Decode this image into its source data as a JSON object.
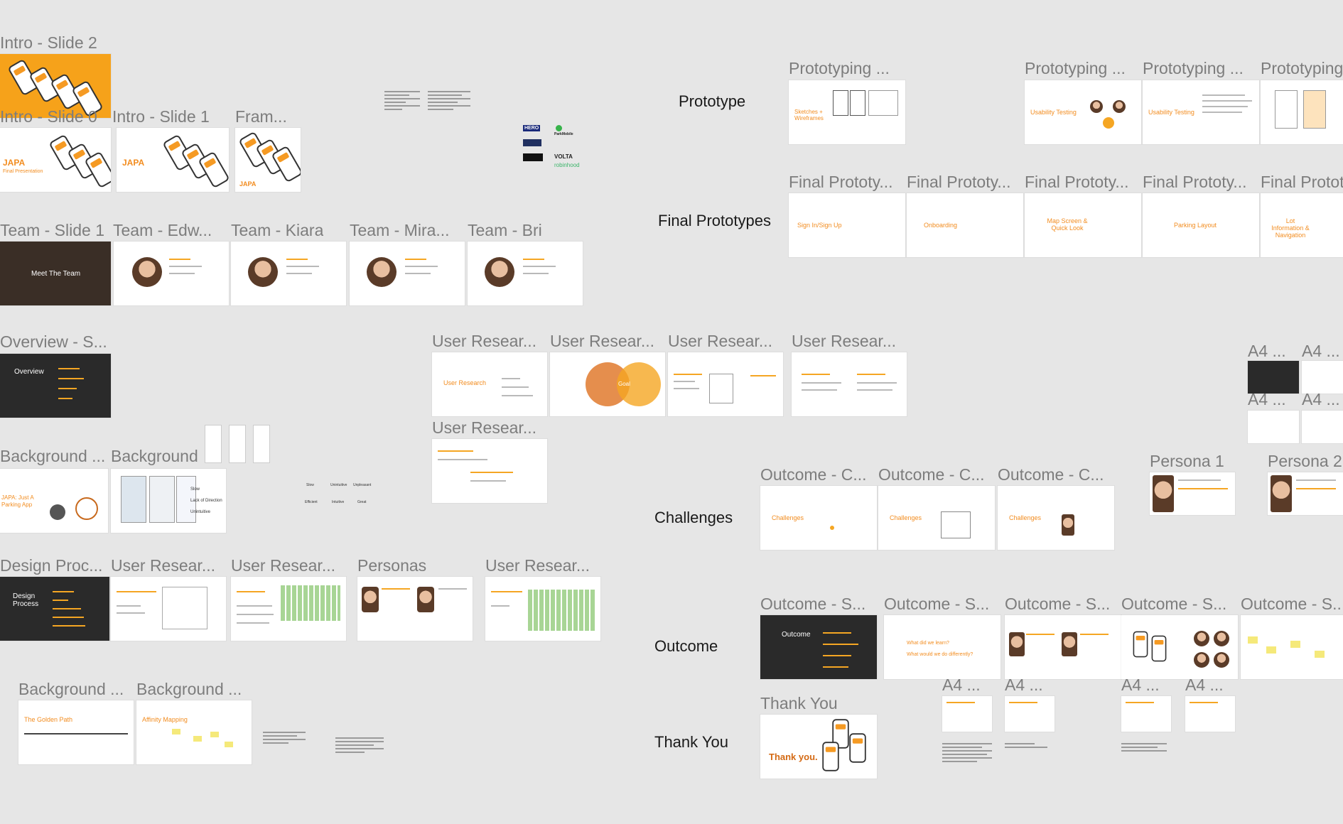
{
  "sections": {
    "prototype": "Prototype",
    "final_prototypes": "Final Prototypes",
    "challenges": "Challenges",
    "outcome": "Outcome",
    "thank_you": "Thank You"
  },
  "frame_labels": {
    "intro_2": "Intro - Slide 2",
    "intro_0": "Intro - Slide 0",
    "intro_1": "Intro - Slide 1",
    "fram": "Fram...",
    "team_1": "Team - Slide 1",
    "team_edw": "Team - Edw...",
    "team_kiara": "Team - Kiara",
    "team_mira": "Team - Mira...",
    "team_bri": "Team - Bri",
    "overview": "Overview - S...",
    "background_a": "Background ...",
    "background_b": "Background",
    "design_proc": "Design Proc...",
    "user_research_1": "User Resear...",
    "user_research_2": "User Resear...",
    "personas": "Personas",
    "user_research_3": "User Resear...",
    "background_c": "Background ...",
    "background_d": "Background ...",
    "ur_top_1": "User Resear...",
    "ur_top_2": "User Resear...",
    "ur_top_3": "User Resear...",
    "ur_top_4": "User Resear...",
    "ur_top_5": "User Resear...",
    "proto_1": "Prototyping ...",
    "proto_2": "Prototyping ...",
    "proto_3": "Prototyping ...",
    "proto_4": "Prototyping",
    "final_1": "Final Prototy...",
    "final_2": "Final Prototy...",
    "final_3": "Final Prototy...",
    "final_4": "Final Prototy...",
    "final_5": "Final Protot",
    "a4_1": "A4 ...",
    "a4_2": "A4 ...",
    "a4_3": "A4 ...",
    "a4_4": "A4 ...",
    "persona_1": "Persona 1",
    "persona_2": "Persona 2",
    "outcome_c1": "Outcome - C...",
    "outcome_c2": "Outcome - C...",
    "outcome_c3": "Outcome - C...",
    "outcome_s1": "Outcome - S...",
    "outcome_s2": "Outcome - S...",
    "outcome_s3": "Outcome - S...",
    "outcome_s4": "Outcome - S...",
    "outcome_s5": "Outcome - S...",
    "a4_5": "A4 ...",
    "a4_6": "A4 ...",
    "a4_7": "A4 ...",
    "a4_8": "A4 ...",
    "thank_you_frame": "Thank You"
  },
  "slide_text": {
    "japa": "JAPA",
    "final_presentation": "Final Presentation",
    "meet_team": "Meet The Team",
    "overview": "Overview",
    "japa_parking": "JAPA: Just A Parking App",
    "design_process": "Design Process",
    "golden_path": "The Golden Path",
    "affinity": "Affinity Mapping",
    "user_research": "User Research",
    "goal": "Goal",
    "sketches": "Sketches + Wireframes",
    "usability_1": "Usability Testing",
    "usability_2": "Usability Testing",
    "signin": "Sign In/Sign Up",
    "onboarding": "Onboarding",
    "map_screen": "Map Screen & Quick Look",
    "parking_layout": "Parking Layout",
    "lot_info": "Lot Information & Navigation",
    "challenges_1": "Challenges",
    "challenges_2": "Challenges",
    "challenges_3": "Challenges",
    "outcome_slide": "Outcome",
    "what_learn": "What did we learn?",
    "what_diff": "What would we do differently?",
    "thank_you": "Thank you.",
    "bg_slow": "Slow",
    "bg_lack": "Lack of Direction",
    "bg_unintuitive": "Unintuitive",
    "flow_1": "Slow",
    "flow_2": "Unintuitive",
    "flow_3": "Unpleasant",
    "flow_4": "Efficient",
    "flow_5": "Intuitive",
    "flow_6": "Great",
    "logo_hero": "HERO",
    "logo_volta": "VOLTA",
    "logo_robinhood": "robinhood",
    "logo_parkmobile": "ParkMobile"
  },
  "colors": {
    "canvas": "#e6e6e6",
    "accent": "#f5a623",
    "label": "#7d7d7d"
  }
}
